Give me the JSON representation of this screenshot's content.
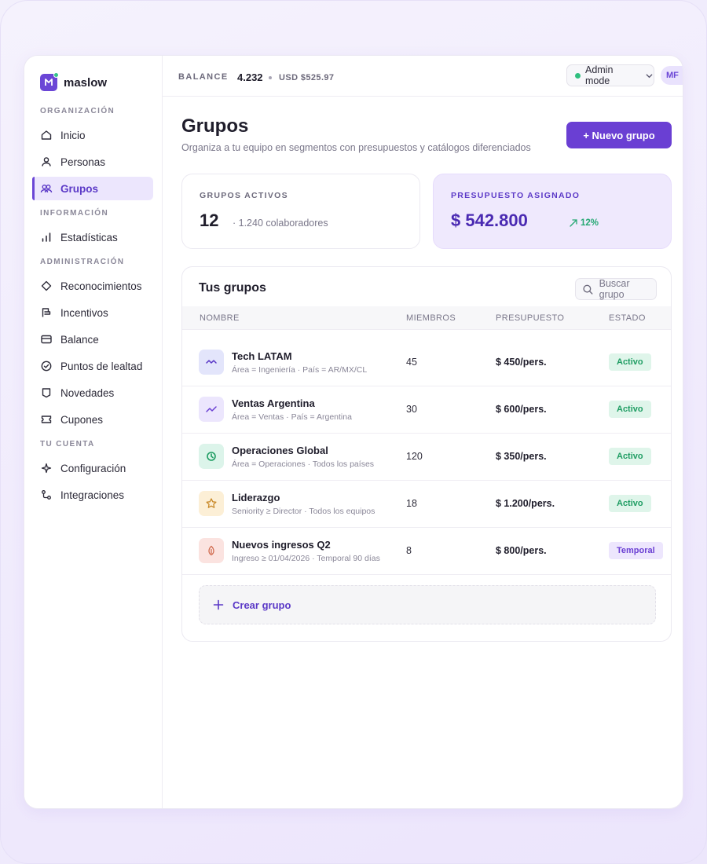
{
  "brand": {
    "name": "maslow"
  },
  "sidebar": {
    "sections": [
      {
        "title": "ORGANIZACIÓN"
      },
      {
        "title": "INFORMACIÓN"
      },
      {
        "title": "ADMINISTRACIÓN"
      },
      {
        "title": "TU CUENTA"
      }
    ],
    "items": [
      {
        "label": "Inicio",
        "icon": "home-icon"
      },
      {
        "label": "Personas",
        "icon": "user-icon"
      },
      {
        "label": "Grupos",
        "icon": "users-icon",
        "active": true
      },
      {
        "label": "Estadísticas",
        "icon": "bar-chart-icon"
      },
      {
        "label": "Reconocimientos",
        "icon": "diamond-icon"
      },
      {
        "label": "Incentivos",
        "icon": "flag-icon"
      },
      {
        "label": "Balance",
        "icon": "card-icon"
      },
      {
        "label": "Puntos de lealtad",
        "icon": "check-circle-icon"
      },
      {
        "label": "Novedades",
        "icon": "bookmark-icon"
      },
      {
        "label": "Cupones",
        "icon": "ticket-icon"
      },
      {
        "label": "Configuración",
        "icon": "sparkle-icon"
      },
      {
        "label": "Integraciones",
        "icon": "integration-icon"
      }
    ]
  },
  "topbar": {
    "balance_label": "BALANCE",
    "balance_value": "4.232",
    "balance_usd": "USD $525.97",
    "admin_mode": "Admin mode",
    "avatar_initials": "MF"
  },
  "page": {
    "title": "Grupos",
    "subtitle": "Organiza a tu equipo en segmentos con presupuestos y catálogos diferenciados",
    "new_button": "+ Nuevo grupo"
  },
  "stats": {
    "active": {
      "label": "GRUPOS ACTIVOS",
      "value": "12",
      "note": "· 1.240 colaboradores"
    },
    "budget": {
      "label": "PRESUPUESTO ASIGNADO",
      "value": "$ 542.800",
      "trend": "12%"
    }
  },
  "groups": {
    "title": "Tus grupos",
    "search_placeholder": "Buscar grupo",
    "columns": [
      "NOMBRE",
      "MIEMBROS",
      "PRESUPUESTO",
      "ESTADO"
    ],
    "rows": [
      {
        "name": "Tech LATAM",
        "sub": "Área = Ingeniería · País = AR/MX/CL",
        "members": "45",
        "budget": "$ 450/pers.",
        "status": "Activo",
        "icon": "wave-icon",
        "icon_bg": "#e3e5fb",
        "icon_color": "#5b39c7"
      },
      {
        "name": "Ventas Argentina",
        "sub": "Área = Ventas · País = Argentina",
        "members": "30",
        "budget": "$ 600/pers.",
        "status": "Activo",
        "icon": "trend-icon",
        "icon_bg": "#ece6fd",
        "icon_color": "#6a3fd3"
      },
      {
        "name": "Operaciones Global",
        "sub": "Área = Operaciones · Todos los países",
        "members": "120",
        "budget": "$ 350/pers.",
        "status": "Activo",
        "icon": "clock-icon",
        "icon_bg": "#dcf4ea",
        "icon_color": "#1f9d63"
      },
      {
        "name": "Liderazgo",
        "sub": "Seniority ≥ Director · Todos los equipos",
        "members": "18",
        "budget": "$ 1.200/pers.",
        "status": "Activo",
        "icon": "star-icon",
        "icon_bg": "#fcefd6",
        "icon_color": "#c98a2a"
      },
      {
        "name": "Nuevos ingresos Q2",
        "sub": "Ingreso ≥ 01/04/2026 · Temporal 90 días",
        "members": "8",
        "budget": "$ 800/pers.",
        "status": "Temporal",
        "icon": "leaf-icon",
        "icon_bg": "#fbe3e0",
        "icon_color": "#d06a4e"
      }
    ],
    "create_label": "Crear grupo"
  }
}
